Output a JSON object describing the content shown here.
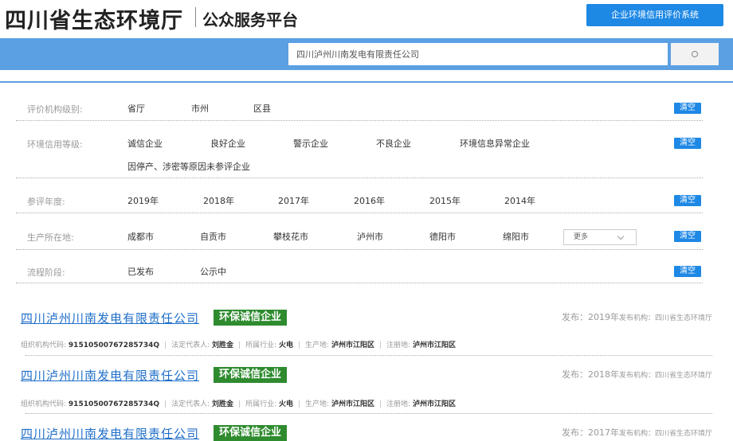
{
  "header": {
    "logo_main": "四川省生态环境厅",
    "logo_sub": "公众服务平台",
    "eval_button": "企业环境信用评价系统"
  },
  "search": {
    "value": "四川泸州川南发电有限责任公司",
    "button_icon": "search-icon"
  },
  "filters": {
    "org_level": {
      "label": "评价机构级别:",
      "options": [
        "省厅",
        "市州",
        "区县"
      ],
      "clear": "清空"
    },
    "credit_level": {
      "label": "环境信用等级:",
      "options": [
        "诚信企业",
        "良好企业",
        "警示企业",
        "不良企业",
        "环境信息异常企业",
        "因停产、涉密等原因未参评企业"
      ],
      "clear": "清空"
    },
    "year": {
      "label": "参评年度:",
      "options": [
        "2019年",
        "2018年",
        "2017年",
        "2016年",
        "2015年",
        "2014年"
      ],
      "clear": "清空"
    },
    "location": {
      "label": "生产所在地:",
      "options": [
        "成都市",
        "自贡市",
        "攀枝花市",
        "泸州市",
        "德阳市",
        "绵阳市"
      ],
      "more": "更多",
      "clear": "清空"
    },
    "stage": {
      "label": "流程阶段:",
      "options": [
        "已发布",
        "公示中"
      ],
      "clear": "清空"
    }
  },
  "results": [
    {
      "name": "四川泸州川南发电有限责任公司",
      "badge": "环保诚信企业",
      "publish": "发布：2019年",
      "org": "发布机构：四川省生态环境厅",
      "code_label": "组织机构代码:",
      "code": "91510500767285734Q",
      "rep_label": "法定代表人:",
      "rep": "刘胜金",
      "industry_label": "所属行业:",
      "industry": "火电",
      "place_label": "生产地:",
      "place": "泸州市江阳区",
      "reg_label": "注册地:",
      "reg": "泸州市江阳区"
    },
    {
      "name": "四川泸州川南发电有限责任公司",
      "badge": "环保诚信企业",
      "publish": "发布：2018年",
      "org": "发布机构：四川省生态环境厅",
      "code_label": "组织机构代码:",
      "code": "91510500767285734Q",
      "rep_label": "法定代表人:",
      "rep": "刘胜金",
      "industry_label": "所属行业:",
      "industry": "火电",
      "place_label": "生产地:",
      "place": "泸州市江阳区",
      "reg_label": "注册地:",
      "reg": "泸州市江阳区"
    },
    {
      "name": "四川泸州川南发电有限责任公司",
      "badge": "环保诚信企业",
      "publish": "发布：2017年",
      "org": "发布机构：四川省生态环境厅"
    }
  ],
  "colors": {
    "accent": "#1e88e5",
    "band": "#5ba0e2",
    "badge": "#2e8b2e",
    "link": "#1e6ec8"
  }
}
